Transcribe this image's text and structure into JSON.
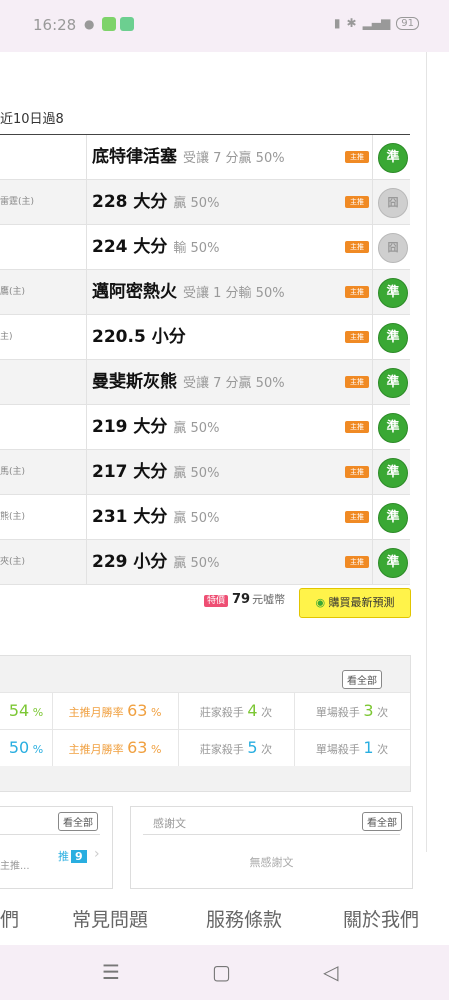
{
  "status_bar": {
    "time": "16:28",
    "battery": "91"
  },
  "recent_label": "近10日過8",
  "rows": [
    {
      "left": "",
      "main": "底特律活塞",
      "sub": "受讓 7 分贏 50%",
      "tag": "主推",
      "result": "準",
      "result_type": "win"
    },
    {
      "left": "雷霆(主)",
      "main": "228 大分",
      "sub": "贏 50%",
      "tag": "主推",
      "result": "囧",
      "result_type": "draw"
    },
    {
      "left": "",
      "main": "224 大分",
      "sub": "輸 50%",
      "tag": "主推",
      "result": "囧",
      "result_type": "draw"
    },
    {
      "left": "鷹(主)",
      "main": "邁阿密熱火",
      "sub": "受讓 1 分輸 50%",
      "tag": "主推",
      "result": "準",
      "result_type": "win"
    },
    {
      "left": "主)",
      "main": "220.5 小分",
      "sub": "",
      "tag": "主推",
      "result": "準",
      "result_type": "win"
    },
    {
      "left": "",
      "main": "曼斐斯灰熊",
      "sub": "受讓 7 分贏 50%",
      "tag": "主推",
      "result": "準",
      "result_type": "win"
    },
    {
      "left": "",
      "main": "219 大分",
      "sub": "贏 50%",
      "tag": "主推",
      "result": "準",
      "result_type": "win"
    },
    {
      "left": "馬(主)",
      "main": "217 大分",
      "sub": "贏 50%",
      "tag": "主推",
      "result": "準",
      "result_type": "win"
    },
    {
      "left": "熊(主)",
      "main": "231 大分",
      "sub": "贏 50%",
      "tag": "主推",
      "result": "準",
      "result_type": "win"
    },
    {
      "left": "夾(主)",
      "main": "229 小分",
      "sub": "贏 50%",
      "tag": "主推",
      "result": "準",
      "result_type": "win"
    }
  ],
  "purchase": {
    "special": "特價",
    "amount": "79",
    "unit": "元噓幣",
    "buy_label": "購買最新預測"
  },
  "stats": {
    "view_all": "看全部",
    "rows": [
      {
        "rate_a": "54",
        "pct": "%",
        "month_label": "主推月勝率",
        "month_rate": "63",
        "zj_label": "莊家殺手",
        "zj_num": "4",
        "times": "次",
        "dc_label": "單場殺手",
        "dc_num": "3"
      },
      {
        "rate_a": "50",
        "pct": "%",
        "month_label": "主推月勝率",
        "month_rate": "63",
        "zj_label": "莊家殺手",
        "zj_num": "5",
        "times": "次",
        "dc_label": "單場殺手",
        "dc_num": "1"
      }
    ]
  },
  "left_box": {
    "view_all": "看全部",
    "text": "主推...",
    "tui_label": "推",
    "tui_num": "9"
  },
  "thanks_box": {
    "title": "感謝文",
    "view_all": "看全部",
    "empty": "無感謝文"
  },
  "footer": {
    "link1": "們",
    "link2": "常見問題",
    "link3": "服務條款",
    "link4": "關於我們"
  },
  "colors": {
    "win": "#3aa834",
    "tag": "#f08a24",
    "green_num": "#7cc734",
    "orange_num": "#f0a040",
    "blue_num": "#29aee0"
  }
}
